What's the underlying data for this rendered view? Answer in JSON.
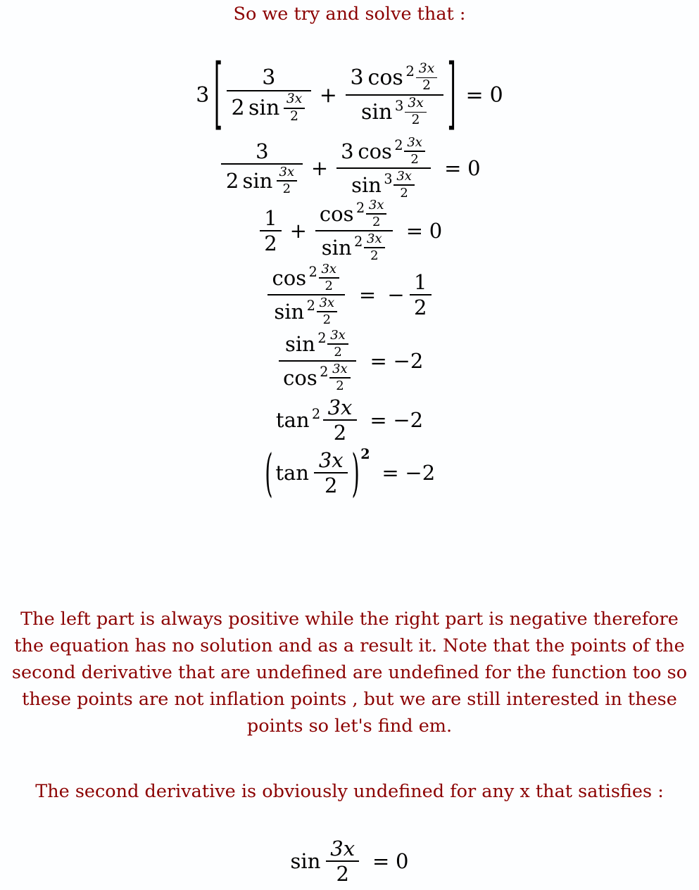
{
  "document": {
    "background_color": "#fdfeff",
    "text_color": "#8b0000",
    "math_color": "#000000",
    "heading": "So we try and solve that :",
    "paragraph_1_lines": [
      "The left part is always positive while the right part is negative therefore",
      "the equation has no solution and as a result it. Note that the points of the",
      "second derivative that are undefined are undefined for the function too so",
      "these points are not inflation points , but we are still interested in these",
      "points so let's find em."
    ],
    "paragraph_2": "The second derivative is obviously undefined for any x that satisfies :",
    "equations": [
      {
        "id": "eq-1",
        "latex": "3\\left[\\frac{3}{2\\sin\\frac{3x}{2}}+\\frac{3\\cos^2\\frac{3x}{2}}{\\sin^3\\frac{3x}{2}}\\right]=0",
        "leading_coefficient": "3",
        "bracket_open": "[",
        "bracket_close": "]",
        "term_1": {
          "numerator": "3",
          "denominator_coefficient": "2",
          "denominator_function": "sin",
          "denominator_arg_num": "3x",
          "denominator_arg_den": "2"
        },
        "plus": "+",
        "term_2": {
          "numerator_coefficient": "3",
          "numerator_function": "cos",
          "numerator_power": "2",
          "numerator_arg_num": "3x",
          "numerator_arg_den": "2",
          "denominator_function": "sin",
          "denominator_power": "3",
          "denominator_arg_num": "3x",
          "denominator_arg_den": "2"
        },
        "relation": "=",
        "rhs": "0"
      },
      {
        "id": "eq-2",
        "latex": "\\frac{3}{2\\sin\\frac{3x}{2}}+\\frac{3\\cos^2\\frac{3x}{2}}{\\sin^3\\frac{3x}{2}}=0",
        "term_1": {
          "numerator": "3",
          "denominator_coefficient": "2",
          "denominator_function": "sin",
          "denominator_arg_num": "3x",
          "denominator_arg_den": "2"
        },
        "plus": "+",
        "term_2": {
          "numerator_coefficient": "3",
          "numerator_function": "cos",
          "numerator_power": "2",
          "numerator_arg_num": "3x",
          "numerator_arg_den": "2",
          "denominator_function": "sin",
          "denominator_power": "3",
          "denominator_arg_num": "3x",
          "denominator_arg_den": "2"
        },
        "relation": "=",
        "rhs": "0"
      },
      {
        "id": "eq-3",
        "latex": "\\frac{1}{2}+\\frac{\\cos^2\\frac{3x}{2}}{\\sin^2\\frac{3x}{2}}=0",
        "term_1": {
          "numerator": "1",
          "denominator": "2"
        },
        "plus": "+",
        "term_2": {
          "numerator_function": "cos",
          "numerator_power": "2",
          "numerator_arg_num": "3x",
          "numerator_arg_den": "2",
          "denominator_function": "sin",
          "denominator_power": "2",
          "denominator_arg_num": "3x",
          "denominator_arg_den": "2"
        },
        "relation": "=",
        "rhs": "0"
      },
      {
        "id": "eq-4",
        "latex": "\\frac{\\cos^2\\frac{3x}{2}}{\\sin^2\\frac{3x}{2}}=-\\frac{1}{2}",
        "term_1": {
          "numerator_function": "cos",
          "numerator_power": "2",
          "numerator_arg_num": "3x",
          "numerator_arg_den": "2",
          "denominator_function": "sin",
          "denominator_power": "2",
          "denominator_arg_num": "3x",
          "denominator_arg_den": "2"
        },
        "relation": "=",
        "rhs_sign": "−",
        "rhs_numerator": "1",
        "rhs_denominator": "2"
      },
      {
        "id": "eq-5",
        "latex": "\\frac{\\sin^2\\frac{3x}{2}}{\\cos^2\\frac{3x}{2}}=-2",
        "term_1": {
          "numerator_function": "sin",
          "numerator_power": "2",
          "numerator_arg_num": "3x",
          "numerator_arg_den": "2",
          "denominator_function": "cos",
          "denominator_power": "2",
          "denominator_arg_num": "3x",
          "denominator_arg_den": "2"
        },
        "relation": "=",
        "rhs": "−2"
      },
      {
        "id": "eq-6",
        "latex": "\\tan^2\\frac{3x}{2}=-2",
        "function": "tan",
        "power": "2",
        "arg_num": "3x",
        "arg_den": "2",
        "relation": "=",
        "rhs": "−2"
      },
      {
        "id": "eq-7",
        "latex": "\\left(\\tan\\frac{3x}{2}\\right)^2=-2",
        "paren_open": "(",
        "paren_close": ")",
        "function": "tan",
        "arg_num": "3x",
        "arg_den": "2",
        "power": "2",
        "relation": "=",
        "rhs": "−2"
      },
      {
        "id": "eq-8",
        "latex": "\\sin\\frac{3x}{2}=0",
        "function": "sin",
        "arg_num": "3x",
        "arg_den": "2",
        "relation": "=",
        "rhs": "0"
      }
    ]
  }
}
